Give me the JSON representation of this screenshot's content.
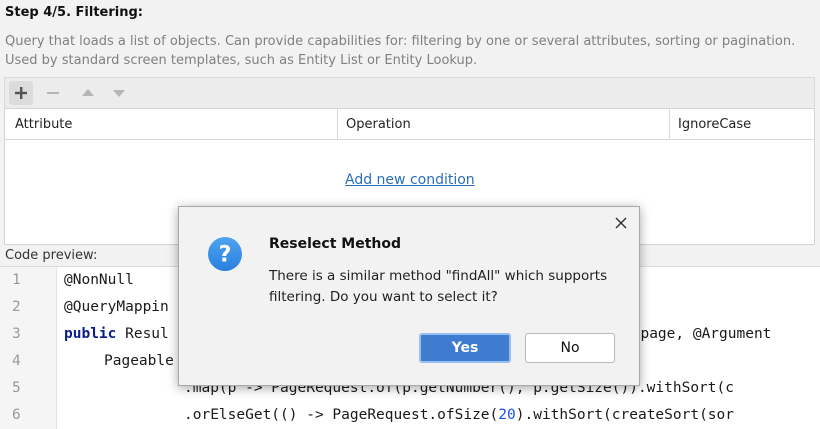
{
  "step": {
    "title": "Step 4/5. Filtering:"
  },
  "description": {
    "line1": "Query that loads a list of objects. Can provide capabilities for: filtering by one or several attributes, sorting or pagination.",
    "line2": "Used by standard screen templates, such as Entity List or Entity Lookup."
  },
  "toolbar": {
    "icons": [
      "add-icon",
      "remove-icon",
      "move-up-icon",
      "move-down-icon"
    ]
  },
  "table": {
    "columns": [
      "Attribute",
      "Operation",
      "IgnoreCase"
    ],
    "add_condition_label": "Add new condition"
  },
  "code_preview": {
    "label": "Code preview:",
    "line_numbers": [
      "1",
      "2",
      "3",
      "4",
      "5",
      "6"
    ],
    "lines": [
      {
        "pre": "",
        "kw": "",
        "text": "@NonNull"
      },
      {
        "pre": "",
        "kw": "",
        "text": "@QueryMappin"
      },
      {
        "pre": "",
        "kw": "public",
        "text": " Resul"
      },
      {
        "pre": "    ",
        "kw": "",
        "text": "Pageable"
      },
      {
        "pre": "",
        "kw": "",
        "text": ".map(p -> PageRequest.of(p.getNumber(), p.getSize()).withSort(c"
      },
      {
        "pre": "",
        "kw": "",
        "text": ".orElseGet(() -> PageRequest.ofSize(",
        "num": "20",
        "post": ").withSort(createSort(sor"
      }
    ],
    "line3_tail": "t page, @Argument"
  },
  "dialog": {
    "title": "Reselect Method",
    "message_line1": "There is a similar method \"findAll\" which supports",
    "message_line2": "filtering. Do you want to select it?",
    "yes_label": "Yes",
    "no_label": "No",
    "icon": "question-icon",
    "close_icon": "close-icon"
  },
  "colors": {
    "accent": "#3d7ccf",
    "link": "#2a6fb6",
    "question_icon": "#3a8ee6",
    "background": "#f2f2f2"
  }
}
